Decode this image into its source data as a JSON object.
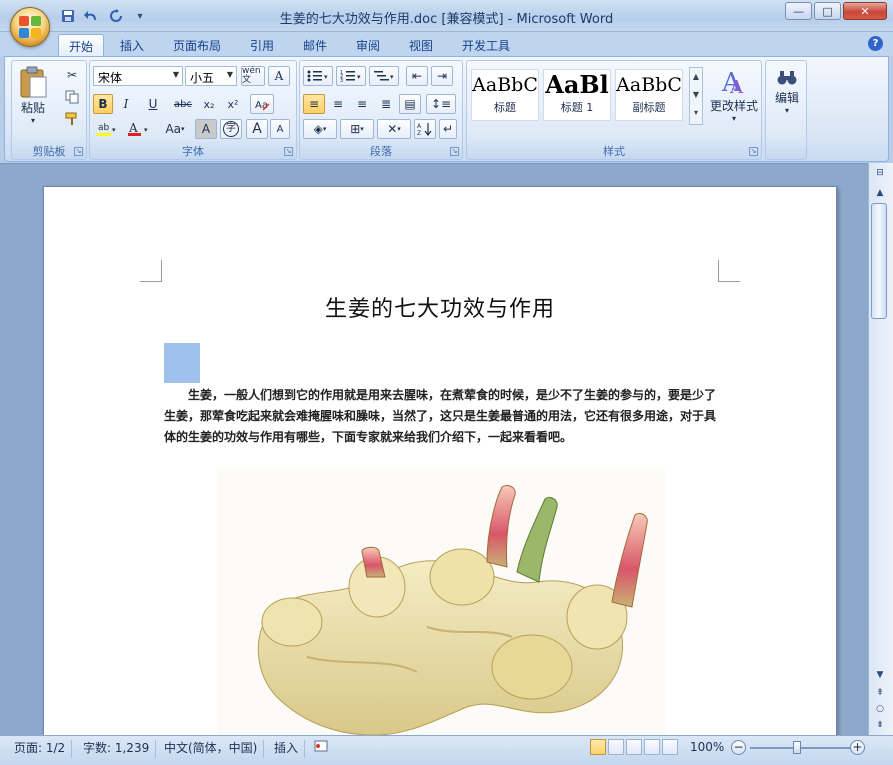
{
  "window": {
    "title": "生姜的七大功效与作用.doc [兼容模式] - Microsoft Word",
    "controls": {
      "minimize": "—",
      "maximize": "□",
      "close": "✕"
    }
  },
  "quick_access": [
    {
      "icon": "save-icon",
      "glyph": "💾"
    },
    {
      "icon": "undo-icon",
      "glyph": "↶"
    },
    {
      "icon": "redo-icon",
      "glyph": "↻"
    },
    {
      "icon": "customize-icon",
      "glyph": "▾"
    }
  ],
  "tabs": [
    "开始",
    "插入",
    "页面布局",
    "引用",
    "邮件",
    "审阅",
    "视图",
    "开发工具"
  ],
  "active_tab": "开始",
  "ribbon": {
    "clipboard": {
      "label": "剪贴板",
      "paste": "粘贴"
    },
    "font": {
      "label": "字体",
      "font_name": "宋体",
      "font_size": "小五",
      "wen_button": "wén 文",
      "bold": "B",
      "italic": "I",
      "underline": "U",
      "strike": "abc",
      "subscript": "x₂",
      "superscript": "x²",
      "change_case": "Aa",
      "char_shading": "A",
      "enclose": "字",
      "grow": "A",
      "shrink": "A"
    },
    "paragraph": {
      "label": "段落"
    },
    "styles": {
      "label": "样式",
      "items": [
        {
          "sample": "AaBbC",
          "name": "标题"
        },
        {
          "sample": "AaBl",
          "name": "标题 1"
        },
        {
          "sample": "AaBbC",
          "name": "副标题"
        }
      ],
      "change_styles": "更改样式"
    },
    "editing": {
      "label": "编辑"
    }
  },
  "document": {
    "title": "生姜的七大功效与作用",
    "paragraph": "生姜，一般人们想到它的作用就是用来去腥味，在煮荤食的时候，是少不了生姜的参与的，要是少了生姜，那荤食吃起来就会难掩腥味和臊味，当然了，这只是生姜最普通的用法，它还有很多用途，对于具体的生姜的功效与作用有哪些，下面专家就来给我们介绍下，一起来看看吧。"
  },
  "statusbar": {
    "page": "页面: 1/2",
    "words": "字数: 1,239",
    "language": "中文(简体，中国)",
    "insert_mode": "插入",
    "zoom": "100%"
  },
  "colors": {
    "highlight": "#ffff00",
    "font_color": "#e02020",
    "selection": "#9fc2ec"
  }
}
